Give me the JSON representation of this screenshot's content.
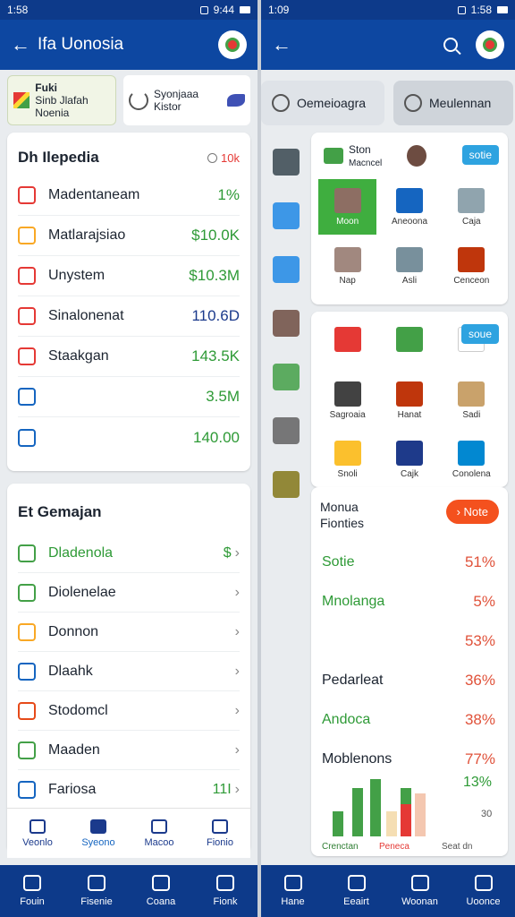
{
  "left": {
    "status": {
      "time": "1:58",
      "right_time": "9:44"
    },
    "appbar": {
      "title": "Ifa Uonosia"
    },
    "chips": [
      {
        "title": "Fuki",
        "subtitle": "Sinb Jlafah Noenia"
      },
      {
        "title": "Syonjaaa",
        "subtitle": "Kistor"
      }
    ],
    "card1": {
      "title": "Dh Ilepedia",
      "badge": "10k",
      "rows": [
        {
          "label": "Madentaneam",
          "value": "1%",
          "color": "green",
          "icon_color": "#e53935"
        },
        {
          "label": "Matlarajsiao",
          "value": "$10.0K",
          "color": "green",
          "icon_color": "#f9a825"
        },
        {
          "label": "Unystem",
          "value": "$10.3M",
          "color": "green",
          "icon_color": "#e53935"
        },
        {
          "label": "Sinalonenat",
          "value": "110.6D",
          "color": "blue",
          "icon_color": "#e53935"
        },
        {
          "label": "Staakgan",
          "value": "143.5K",
          "color": "green",
          "icon_color": "#e53935"
        },
        {
          "label": "",
          "value": "3.5M",
          "color": "green",
          "icon_color": "#1565c0"
        },
        {
          "label": "",
          "value": "140.00",
          "color": "green",
          "icon_color": "#1565c0"
        }
      ]
    },
    "card2": {
      "title": "Et Gemajan",
      "rows": [
        {
          "label": "Dladenola",
          "suffix": "$",
          "icon_color": "#43a047",
          "color": "green"
        },
        {
          "label": "Diolenelae",
          "suffix": "",
          "icon_color": "#43a047",
          "color": ""
        },
        {
          "label": "Donnon",
          "suffix": "",
          "icon_color": "#f9a825",
          "color": ""
        },
        {
          "label": "Dlaahk",
          "suffix": "",
          "icon_color": "#1565c0",
          "color": ""
        },
        {
          "label": "Stodomcl",
          "suffix": "",
          "icon_color": "#e64a19",
          "color": ""
        },
        {
          "label": "Maaden",
          "suffix": "",
          "icon_color": "#43a047",
          "color": ""
        },
        {
          "label": "Fariosa",
          "suffix": "11I",
          "icon_color": "#1565c0",
          "color": ""
        }
      ]
    },
    "tabs": [
      "Veonlo",
      "Syeono",
      "Macoo",
      "Fionio"
    ],
    "nav": [
      "Fouin",
      "Fisenie",
      "Coana",
      "Fionk"
    ]
  },
  "right": {
    "status": {
      "time": "1:09",
      "right_time": "1:58"
    },
    "chips": [
      {
        "label": "Oemeioagra"
      },
      {
        "label": "Meulennan"
      }
    ],
    "panel1": {
      "head_title": "Ston",
      "head_sub": "Macncel",
      "button": "sotie",
      "cells": [
        {
          "label": "Moon",
          "color": "#8d6e63"
        },
        {
          "label": "Aneoona",
          "color": "#1565c0"
        },
        {
          "label": "Caja",
          "color": "#90a4ae"
        },
        {
          "label": "Nap",
          "color": "#a1887f"
        },
        {
          "label": "Asli",
          "color": "#78909c"
        },
        {
          "label": "Cenceon",
          "color": "#bf360c"
        }
      ]
    },
    "panel2": {
      "button": "soue",
      "cells": [
        {
          "label": "",
          "color": "#e53935"
        },
        {
          "label": "",
          "color": "#43a047"
        },
        {
          "label": "",
          "color": "#ffffff"
        },
        {
          "label": "Sagroaia",
          "color": "#424242"
        },
        {
          "label": "Hanat",
          "color": "#bf360c"
        },
        {
          "label": "Sadi",
          "color": "#c9a26b"
        },
        {
          "label": "Snoli",
          "color": "#fbc02d"
        },
        {
          "label": "Cajk",
          "color": "#1e3a8a"
        },
        {
          "label": "Conolena",
          "color": "#0288d1"
        }
      ]
    },
    "panel3": {
      "title1": "Monua",
      "title2": "Fionties",
      "button": "Note",
      "rows": [
        {
          "label": "Sotie",
          "value": "51%",
          "color": "green"
        },
        {
          "label": "Mnolanga",
          "value": "5%",
          "color": "green"
        },
        {
          "label": "",
          "value": "53%",
          "color": ""
        },
        {
          "label": "Pedarleat",
          "value": "36%",
          "color": ""
        },
        {
          "label": "Andoca",
          "value": "38%",
          "color": "green"
        },
        {
          "label": "Moblenons",
          "value": "77%",
          "color": ""
        }
      ],
      "extra_value": "13%",
      "chart_labels": [
        "Crenctan",
        "Peneca",
        "Seat dn"
      ],
      "chart_corner": "30"
    },
    "nav": [
      "Hane",
      "Eeairt",
      "Woonan",
      "Uoonce"
    ]
  },
  "rail_colors": [
    "#37474f",
    "#43a047",
    "#1e88e5",
    "#8d6e63",
    "#1e88e5",
    "#1e88e5",
    "#6d4c41",
    "#1e88e5",
    "#43a047",
    "#43a047",
    "#616161",
    "#616161",
    "#827717",
    "#1e88e5"
  ]
}
